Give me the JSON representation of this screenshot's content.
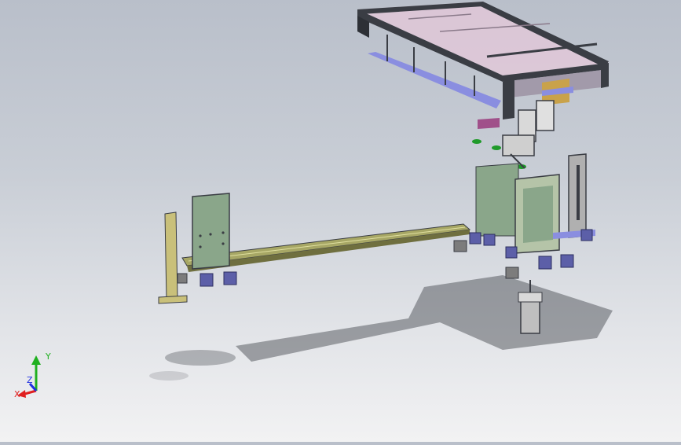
{
  "viewport": {
    "background_top": "#b9bfca",
    "background_bottom": "#f2f2f3"
  },
  "model": {
    "frame_color": "#3a3d44",
    "glass_color": "#e6c8da",
    "rail_color": "#a7a765",
    "plate_color": "#8aa68a",
    "bracket_color": "#5c5fa8",
    "blue_bar_color": "#8a8ee0",
    "motor_color": "#bfbfbf"
  },
  "triad": {
    "x_label": "X",
    "y_label": "Y",
    "z_label": "Z",
    "x_color": "#e02020",
    "y_color": "#20b020",
    "z_color": "#2030e0"
  }
}
